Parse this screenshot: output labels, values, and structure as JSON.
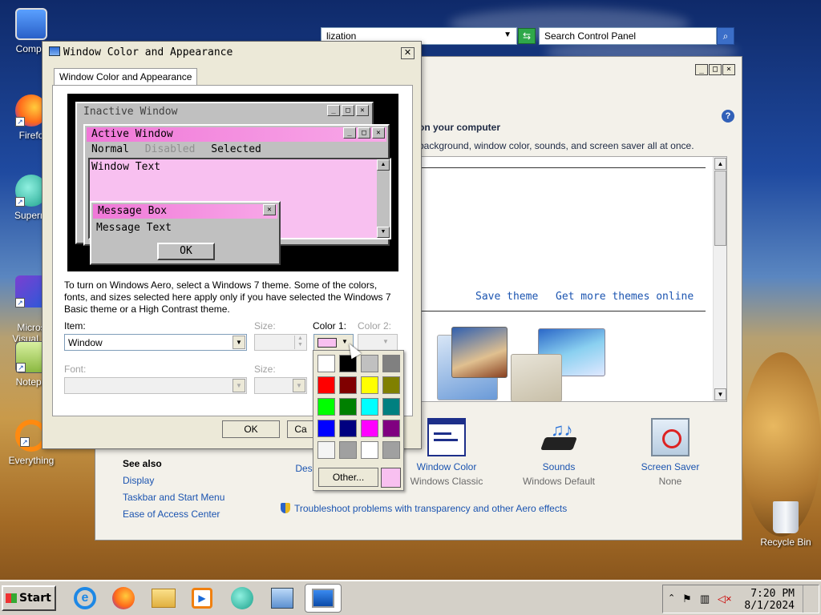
{
  "desktop": {
    "icons": [
      {
        "label": "Compu"
      },
      {
        "label": "Firefo"
      },
      {
        "label": "Superm"
      },
      {
        "label": "Micros\nVisual St"
      },
      {
        "label": "Notepa"
      },
      {
        "label": "Everything"
      },
      {
        "label": "Recycle Bin"
      }
    ]
  },
  "control_panel": {
    "address": "lization",
    "search_placeholder": "Search Control Panel",
    "heading": "on your computer",
    "subheading": "background, window color, sounds, and screen saver all at once.",
    "save_theme": "Save theme",
    "get_more": "Get more themes online",
    "bottom_items": [
      {
        "name": "Desk",
        "value": ""
      },
      {
        "name": "Window Color",
        "value": "Windows Classic"
      },
      {
        "name": "Sounds",
        "value": "Windows Default"
      },
      {
        "name": "Screen Saver",
        "value": "None"
      }
    ],
    "see_also": {
      "title": "See also",
      "links": [
        "Display",
        "Taskbar and Start Menu",
        "Ease of Access Center"
      ]
    },
    "troubleshoot": "Troubleshoot problems with transparency and other Aero effects"
  },
  "dialog": {
    "title": "Window Color and Appearance",
    "tab": "Window Color and Appearance",
    "preview": {
      "inactive_title": "Inactive Window",
      "active_title": "Active Window",
      "menu": [
        "Normal",
        "Disabled",
        "Selected"
      ],
      "window_text": "Window Text",
      "msgbox_title": "Message Box",
      "msgbox_text": "Message Text",
      "ok": "OK"
    },
    "hint": "To turn on Windows Aero, select a Windows 7 theme.  Some of the colors, fonts, and sizes selected here apply only if you have selected the Windows 7 Basic theme or a High Contrast theme.",
    "item_label": "Item:",
    "item_value": "Window",
    "size_label": "Size:",
    "color1_label": "Color 1:",
    "color2_label": "Color 2:",
    "font_label": "Font:",
    "size2_label": "Size:",
    "ok": "OK",
    "cancel": "Ca",
    "selected_color": "#f8c0f0"
  },
  "palette": {
    "colors": [
      "#ffffff",
      "#000000",
      "#c0c0c0",
      "#808080",
      "#ff0000",
      "#800000",
      "#ffff00",
      "#808000",
      "#00ff00",
      "#008000",
      "#00ffff",
      "#008080",
      "#0000ff",
      "#000080",
      "#ff00ff",
      "#800080",
      "#f4f4f4",
      "#a0a0a0",
      "#ffffff",
      "#a0a0a0"
    ],
    "other_label": "Other..."
  },
  "taskbar": {
    "start_label": "Start",
    "time": "7:20 PM",
    "date": "8/1/2024"
  }
}
